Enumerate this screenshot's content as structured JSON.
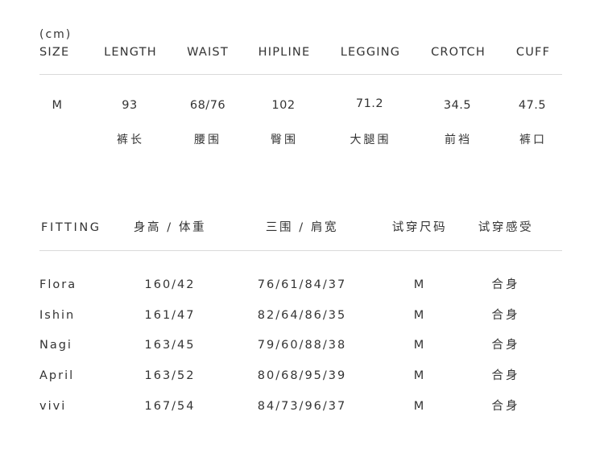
{
  "size_table": {
    "unit": "(cm)",
    "headers": [
      "SIZE",
      "LENGTH",
      "WAIST",
      "HIPLINE",
      "LEGGING",
      "CROTCH",
      "CUFF"
    ],
    "values": [
      "M",
      "93",
      "68/76",
      "102",
      "71.2",
      "34.5",
      "47.5"
    ],
    "cn_labels": [
      "裤长",
      "腰围",
      "臀围",
      "大腿围",
      "前裆",
      "裤口"
    ]
  },
  "fitting_table": {
    "headers": [
      "FITTING",
      "身高 / 体重",
      "三围 / 肩宽",
      "试穿尺码",
      "试穿感受"
    ],
    "rows": [
      {
        "name": "Flora",
        "height_weight": "160/42",
        "measurements": "76/61/84/37",
        "size": "M",
        "feel": "合身"
      },
      {
        "name": "Ishin",
        "height_weight": "161/47",
        "measurements": "82/64/86/35",
        "size": "M",
        "feel": "合身"
      },
      {
        "name": "Nagi",
        "height_weight": "163/45",
        "measurements": "79/60/88/38",
        "size": "M",
        "feel": "合身"
      },
      {
        "name": "April",
        "height_weight": "163/52",
        "measurements": "80/68/95/39",
        "size": "M",
        "feel": "合身"
      },
      {
        "name": "vivi",
        "height_weight": "167/54",
        "measurements": "84/73/96/37",
        "size": "M",
        "feel": "合身"
      }
    ]
  }
}
